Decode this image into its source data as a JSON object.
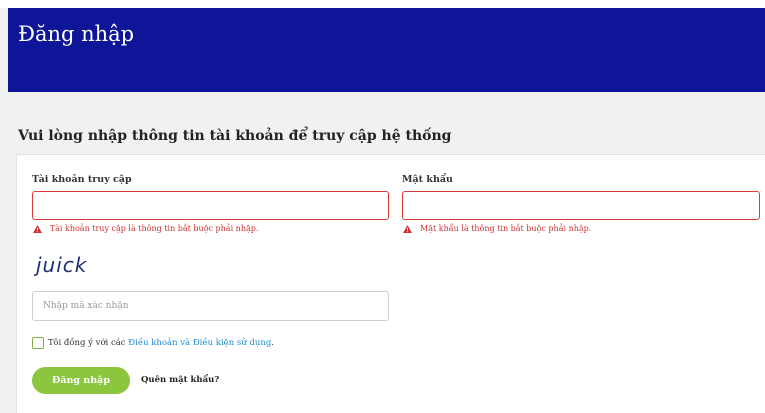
{
  "header": {
    "title": "Đăng nhập"
  },
  "form": {
    "instruction": "Vui lòng nhập thông tin tài khoản để truy cập hệ thống",
    "username": {
      "label": "Tài khoản truy cập",
      "value": "",
      "error": "Tài khoản truy cập là thông tin bắt buộc phải nhập."
    },
    "password": {
      "label": "Mật khẩu",
      "value": "",
      "error": "Mật khẩu là thông tin bắt buộc phải nhập."
    },
    "captcha": {
      "image_text": "juick",
      "placeholder": "Nhập mã xác nhận"
    },
    "agree": {
      "prefix": "Tôi đồng ý với các ",
      "link": "Điều khoản và Điều kiện sử dụng",
      "suffix": "."
    },
    "login_button": "Đăng nhập",
    "forgot_link": "Quên mật khẩu?"
  },
  "colors": {
    "header_bg": "#0f1598",
    "error": "#d93a3a",
    "button": "#8cc63f",
    "link": "#1a8bd0"
  },
  "icons": [
    "warning-icon",
    "checkbox-icon"
  ]
}
